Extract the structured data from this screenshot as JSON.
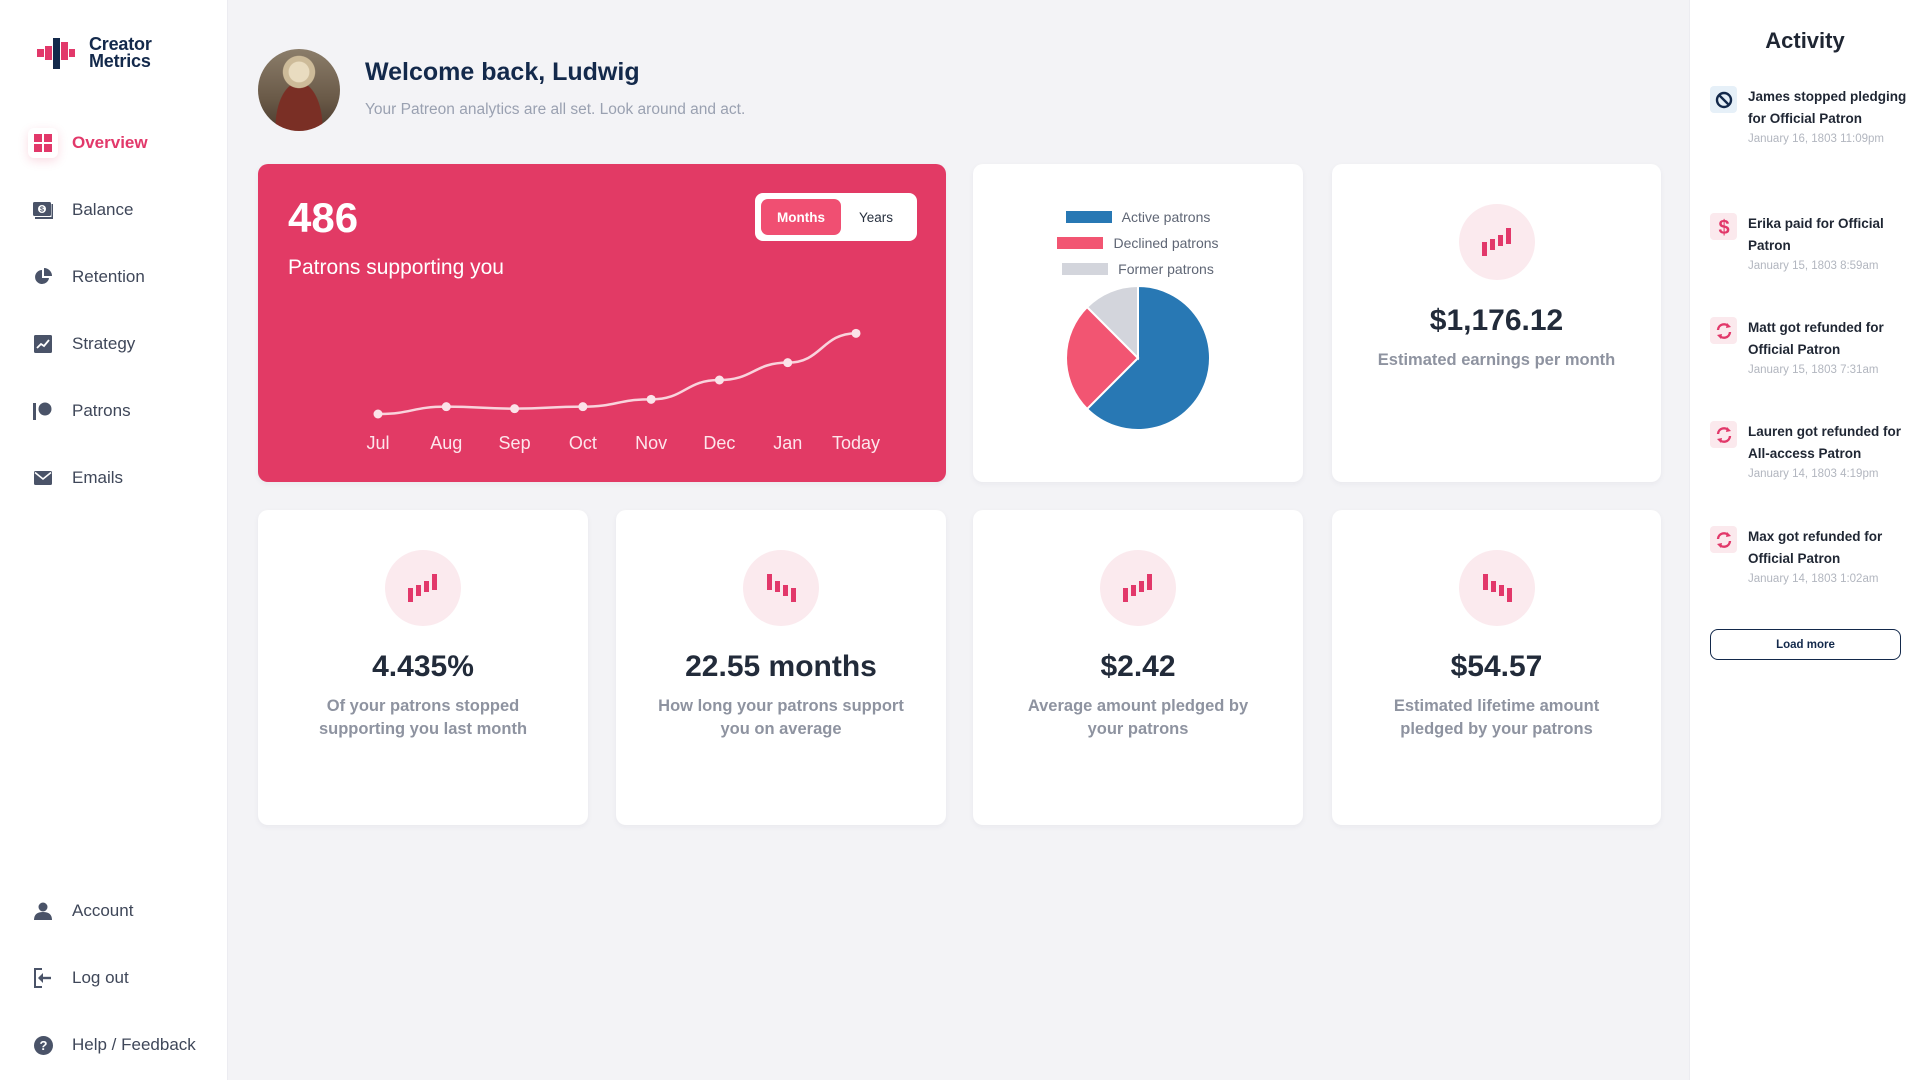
{
  "app": {
    "name_line1": "Creator",
    "name_line2": "Metrics"
  },
  "colors": {
    "accent": "#e2386a",
    "navy": "#13294b",
    "active_patrons": "#2878b4",
    "declined_patrons": "#f25572",
    "former_patrons": "#d3d5dc"
  },
  "sidebar": {
    "items": [
      {
        "label": "Overview",
        "icon": "grid-icon",
        "active": true
      },
      {
        "label": "Balance",
        "icon": "money-icon"
      },
      {
        "label": "Retention",
        "icon": "pie-chart-icon"
      },
      {
        "label": "Strategy",
        "icon": "line-chart-icon"
      },
      {
        "label": "Patrons",
        "icon": "patreon-icon"
      },
      {
        "label": "Emails",
        "icon": "envelope-icon"
      }
    ],
    "bottom_items": [
      {
        "label": "Account",
        "icon": "user-icon"
      },
      {
        "label": "Log out",
        "icon": "logout-icon"
      },
      {
        "label": "Help / Feedback",
        "icon": "help-icon"
      }
    ]
  },
  "header": {
    "title": "Welcome back, Ludwig",
    "subtitle": "Your Patreon analytics are all set. Look around and act."
  },
  "patrons_card": {
    "value": "486",
    "label": "Patrons supporting you",
    "toggle": {
      "options": [
        "Months",
        "Years"
      ],
      "selected": "Months"
    }
  },
  "chart_data": [
    {
      "type": "line",
      "title": "Patrons supporting you",
      "categories": [
        "Jul",
        "Aug",
        "Sep",
        "Oct",
        "Nov",
        "Dec",
        "Jan",
        "Today"
      ],
      "values": [
        330,
        352,
        346,
        352,
        374,
        432,
        484,
        572
      ],
      "xlabel": "",
      "ylabel": "",
      "grid": false,
      "ylim": [
        300,
        600
      ]
    },
    {
      "type": "pie",
      "title": "",
      "legend": [
        "Active patrons",
        "Declined patrons",
        "Former patrons"
      ],
      "legend_position": "top",
      "values": [
        62.5,
        25,
        12.5
      ],
      "unit": "percent"
    }
  ],
  "stats": {
    "earnings": {
      "value": "$1,176.12",
      "desc": "Estimated earnings per month",
      "trend": "up"
    },
    "churn": {
      "value": "4.435%",
      "desc": "Of your patrons stopped supporting you last month",
      "trend": "up"
    },
    "duration": {
      "value": "22.55 months",
      "desc": "How long your patrons support you on average",
      "trend": "down"
    },
    "avg_pledge": {
      "value": "$2.42",
      "desc": "Average amount pledged by your patrons",
      "trend": "up"
    },
    "lifetime": {
      "value": "$54.57",
      "desc": "Estimated lifetime amount pledged by your patrons",
      "trend": "down"
    }
  },
  "activity": {
    "title": "Activity",
    "items": [
      {
        "text": "James stopped pledging for Official Patron",
        "time": "January 16, 1803 11:09pm",
        "icon": "ban-icon"
      },
      {
        "text": "Erika paid for Official Patron",
        "time": "January 15, 1803 8:59am",
        "icon": "dollar-icon"
      },
      {
        "text": "Matt got refunded for Official Patron",
        "time": "January 15, 1803 7:31am",
        "icon": "refresh-icon"
      },
      {
        "text": "Lauren got refunded for All-access Patron",
        "time": "January 14, 1803 4:19pm",
        "icon": "refresh-icon"
      },
      {
        "text": "Max got refunded for Official Patron",
        "time": "January 14, 1803 1:02am",
        "icon": "refresh-icon"
      }
    ],
    "load_more_label": "Load more"
  }
}
